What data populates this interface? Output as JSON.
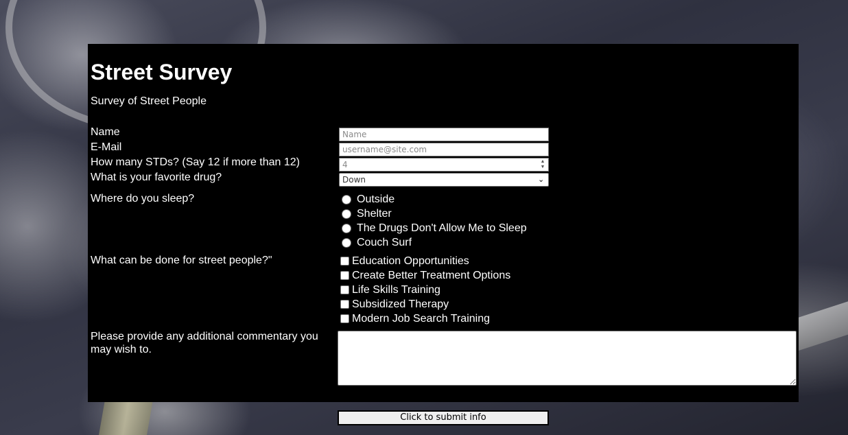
{
  "header": {
    "title": "Street Survey",
    "subtitle": "Survey of Street People"
  },
  "fields": {
    "name": {
      "label": "Name",
      "placeholder": "Name"
    },
    "email": {
      "label": "E-Mail",
      "placeholder": "username@site.com"
    },
    "stds": {
      "label": "How many STDs? (Say 12 if more than 12)",
      "value": "4"
    },
    "drug": {
      "label": "What is your favorite drug?",
      "selected": "Down"
    }
  },
  "sleep": {
    "question": "Where do you sleep?",
    "options": [
      "Outside",
      "Shelter",
      "The Drugs Don't Allow Me to Sleep",
      "Couch Surf"
    ]
  },
  "help": {
    "question": "What can be done for street people?\"",
    "options": [
      "Education Opportunities",
      "Create Better Treatment Options",
      "Life Skills Training",
      "Subsidized Therapy",
      "Modern Job Search Training"
    ]
  },
  "comment": {
    "label": "Please provide any additional commentary you may wish to."
  },
  "submit": {
    "label": "Click to submit info"
  }
}
